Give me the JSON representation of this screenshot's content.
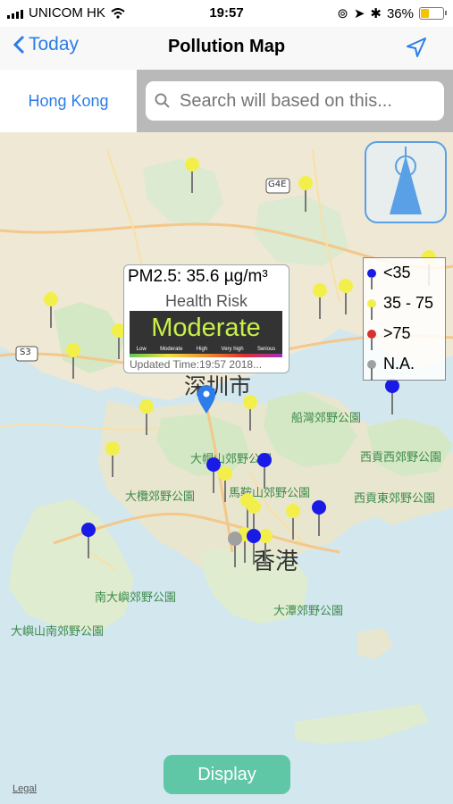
{
  "status": {
    "carrier": "UNICOM HK",
    "time": "19:57",
    "battery": "36%",
    "battery_level": 0.36
  },
  "nav": {
    "back_label": "Today",
    "title": "Pollution Map"
  },
  "search": {
    "city": "Hong Kong",
    "placeholder": "Search will based on this..."
  },
  "map": {
    "labels": {
      "shenzhen": "深圳市",
      "hongkong": "香港",
      "g4e": "G4E",
      "s3": "S3",
      "taimoshan": "大帽山郊野公園",
      "tailam": "大欖郊野公園",
      "maonshan": "馬鞍山郊野公園",
      "saikung": "船灣郊野公園",
      "saikungwest": "西貢西郊野公園",
      "saikungeast": "西貢東郊野公園",
      "southlantau": "南大嶼郊野公園",
      "lantau": "大嶼山南郊野公園",
      "taitam": "大潭郊野公園"
    },
    "colors": {
      "blue": "#1a1ae6",
      "yellow": "#f3ef4a",
      "red": "#d83030",
      "gray": "#a0a0a0",
      "selected": "#2b7de9"
    }
  },
  "popup": {
    "pm_label": "PM2.5: 35.6 µg/m³",
    "risk_label": "Health Risk",
    "level": "Moderate",
    "scale": [
      "Low",
      "Moderate",
      "High",
      "Very high",
      "Serious"
    ],
    "updated": "Updated Time:19:57  2018..."
  },
  "legend": [
    {
      "label": "<35",
      "color": "#1a1ae6"
    },
    {
      "label": "35 - 75",
      "color": "#f3ef4a"
    },
    {
      "label": ">75",
      "color": "#d83030"
    },
    {
      "label": "N.A.",
      "color": "#a0a0a0"
    }
  ],
  "footer": {
    "display_label": "Display",
    "legal_label": "Legal"
  }
}
